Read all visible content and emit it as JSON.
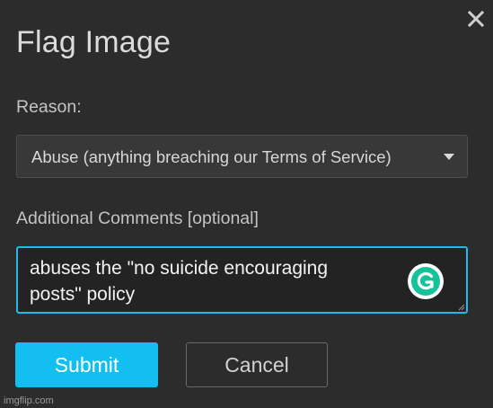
{
  "dialog": {
    "title": "Flag Image",
    "close_icon": "close-icon"
  },
  "form": {
    "reason_label": "Reason:",
    "reason_selected": "Abuse (anything breaching our Terms of Service)",
    "comments_label": "Additional Comments [optional]",
    "comments_value": "abuses the \"no suicide encouraging\nposts\" policy",
    "grammarly_icon": "grammarly-icon"
  },
  "actions": {
    "submit_label": "Submit",
    "cancel_label": "Cancel"
  },
  "watermark": {
    "text": "imgflip.com"
  },
  "colors": {
    "background": "#2c2c2c",
    "accent": "#12bff0",
    "focus_border": "#1bbce8",
    "grammarly_green": "#15c39a"
  }
}
